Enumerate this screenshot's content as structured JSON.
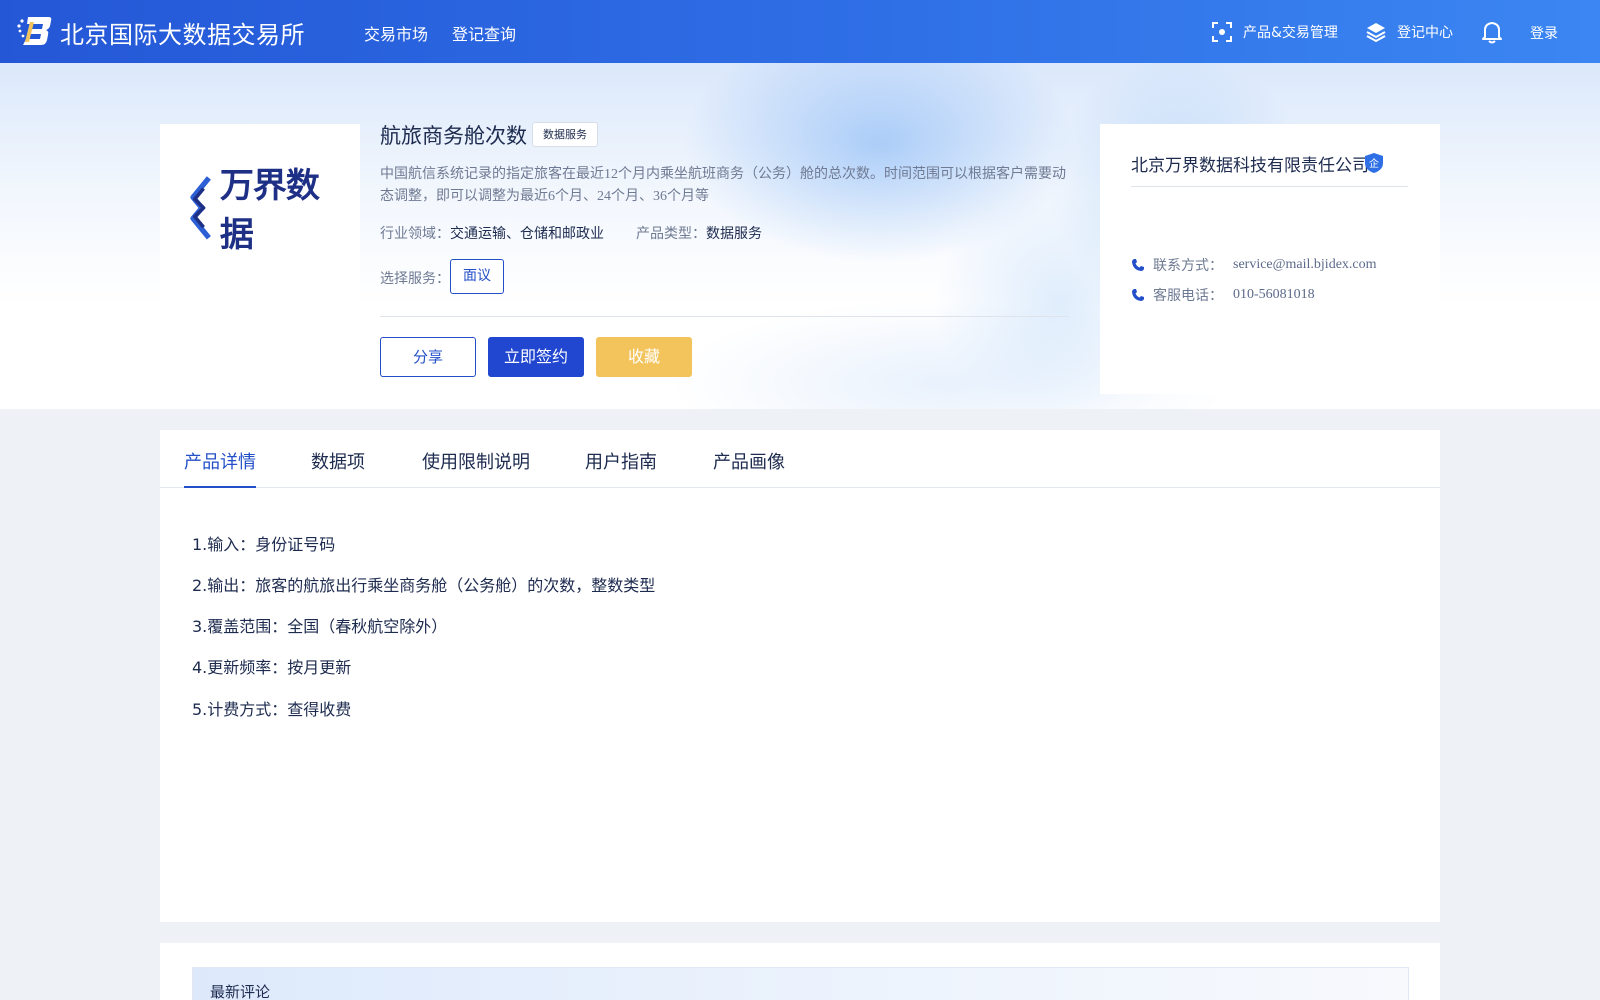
{
  "header": {
    "site_title": "北京国际大数据交易所",
    "nav": [
      "交易市场",
      "登记查询"
    ],
    "product_mgmt": "产品&交易管理",
    "register_center": "登记中心",
    "login": "登录"
  },
  "product": {
    "logo_text": "万界数据",
    "title": "航旅商务舱次数",
    "tag": "数据服务",
    "description": "中国航信系统记录的指定旅客在最近12个月内乘坐航班商务（公务）舱的总次数。时间范围可以根据客户需要动态调整，即可以调整为最近6个月、24个月、36个月等",
    "industry_label": "行业领域：",
    "industry_value": "交通运输、仓储和邮政业",
    "type_label": "产品类型：",
    "type_value": "数据服务",
    "service_label": "选择服务：",
    "service_option": "面议",
    "buttons": {
      "share": "分享",
      "sign": "立即签约",
      "favorite": "收藏"
    }
  },
  "company": {
    "name": "北京万界数据科技有限责任公司",
    "badge": "企",
    "contact_label": "联系方式：",
    "contact_value": "service@mail.bjidex.com",
    "phone_label": "客服电话：",
    "phone_value": "010-56081018"
  },
  "tabs": [
    "产品详情",
    "数据项",
    "使用限制说明",
    "用户指南",
    "产品画像"
  ],
  "details": [
    "1.输入：身份证号码",
    "2.输出：旅客的航旅出行乘坐商务舱（公务舱）的次数，整数类型",
    "3.覆盖范围：全国（春秋航空除外）",
    "4.更新频率：按月更新",
    "5.计费方式：查得收费"
  ],
  "comments": {
    "title": "最新评论"
  },
  "colors": {
    "primary": "#2146cf",
    "accent_yellow": "#f3c45c",
    "header_start": "#2457d6",
    "header_end": "#3b86f2"
  }
}
